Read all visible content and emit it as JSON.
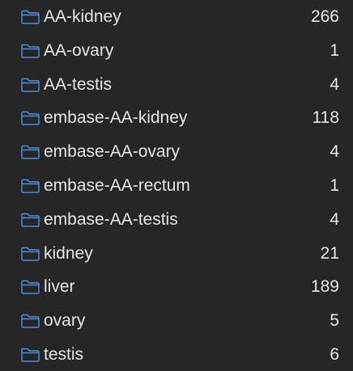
{
  "colors": {
    "background": "#262626",
    "text": "#e6e6e6",
    "folder_icon": "#4f8fdf"
  },
  "folders": [
    {
      "name": "AA-kidney",
      "count": "266",
      "icon": "folder-icon"
    },
    {
      "name": "AA-ovary",
      "count": "1",
      "icon": "folder-icon"
    },
    {
      "name": "AA-testis",
      "count": "4",
      "icon": "folder-icon"
    },
    {
      "name": "embase-AA-kidney",
      "count": "118",
      "icon": "folder-icon"
    },
    {
      "name": "embase-AA-ovary",
      "count": "4",
      "icon": "folder-icon"
    },
    {
      "name": "embase-AA-rectum",
      "count": "1",
      "icon": "folder-icon"
    },
    {
      "name": "embase-AA-testis",
      "count": "4",
      "icon": "folder-icon"
    },
    {
      "name": "kidney",
      "count": "21",
      "icon": "folder-icon"
    },
    {
      "name": "liver",
      "count": "189",
      "icon": "folder-icon"
    },
    {
      "name": "ovary",
      "count": "5",
      "icon": "folder-icon"
    },
    {
      "name": "testis",
      "count": "6",
      "icon": "folder-icon"
    }
  ]
}
